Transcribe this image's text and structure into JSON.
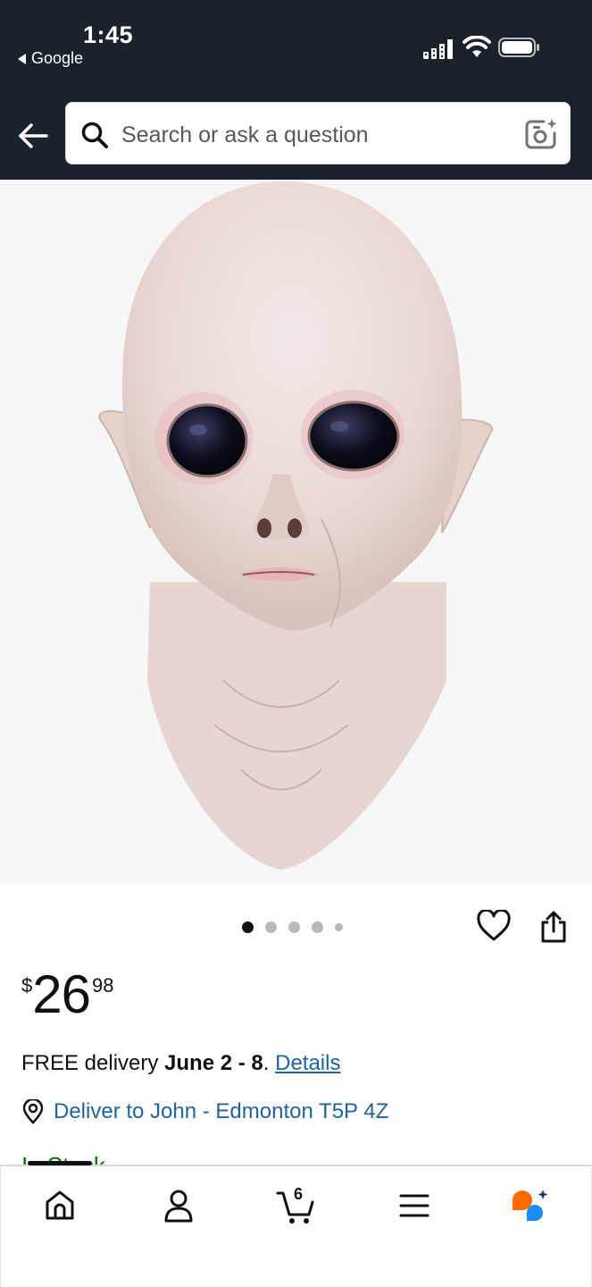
{
  "status_bar": {
    "time": "1:45",
    "back_app": "Google"
  },
  "header": {
    "search_placeholder": "Search or ask a question"
  },
  "product": {
    "image_icon": "alien-latex-mask-image",
    "carousel": {
      "count": 5,
      "active_index": 0
    },
    "price": {
      "currency": "$",
      "whole": "26",
      "fraction": "98"
    },
    "delivery": {
      "prefix": "FREE delivery ",
      "dates": "June 2 - 8",
      "suffix": ". ",
      "details_link": "Details"
    },
    "deliver_to": "Deliver to John - Edmonton T5P 4Z",
    "stock": "In Stock"
  },
  "bottom_nav": {
    "cart_count": "6",
    "items": [
      "home-icon",
      "account-icon",
      "cart-icon",
      "menu-icon",
      "rufus-icon"
    ]
  },
  "colors": {
    "header_bg": "#1a222c",
    "link": "#2162a1",
    "in_stock": "#007600",
    "rufus_orange": "#ff6a00",
    "rufus_blue": "#1a8cff"
  }
}
